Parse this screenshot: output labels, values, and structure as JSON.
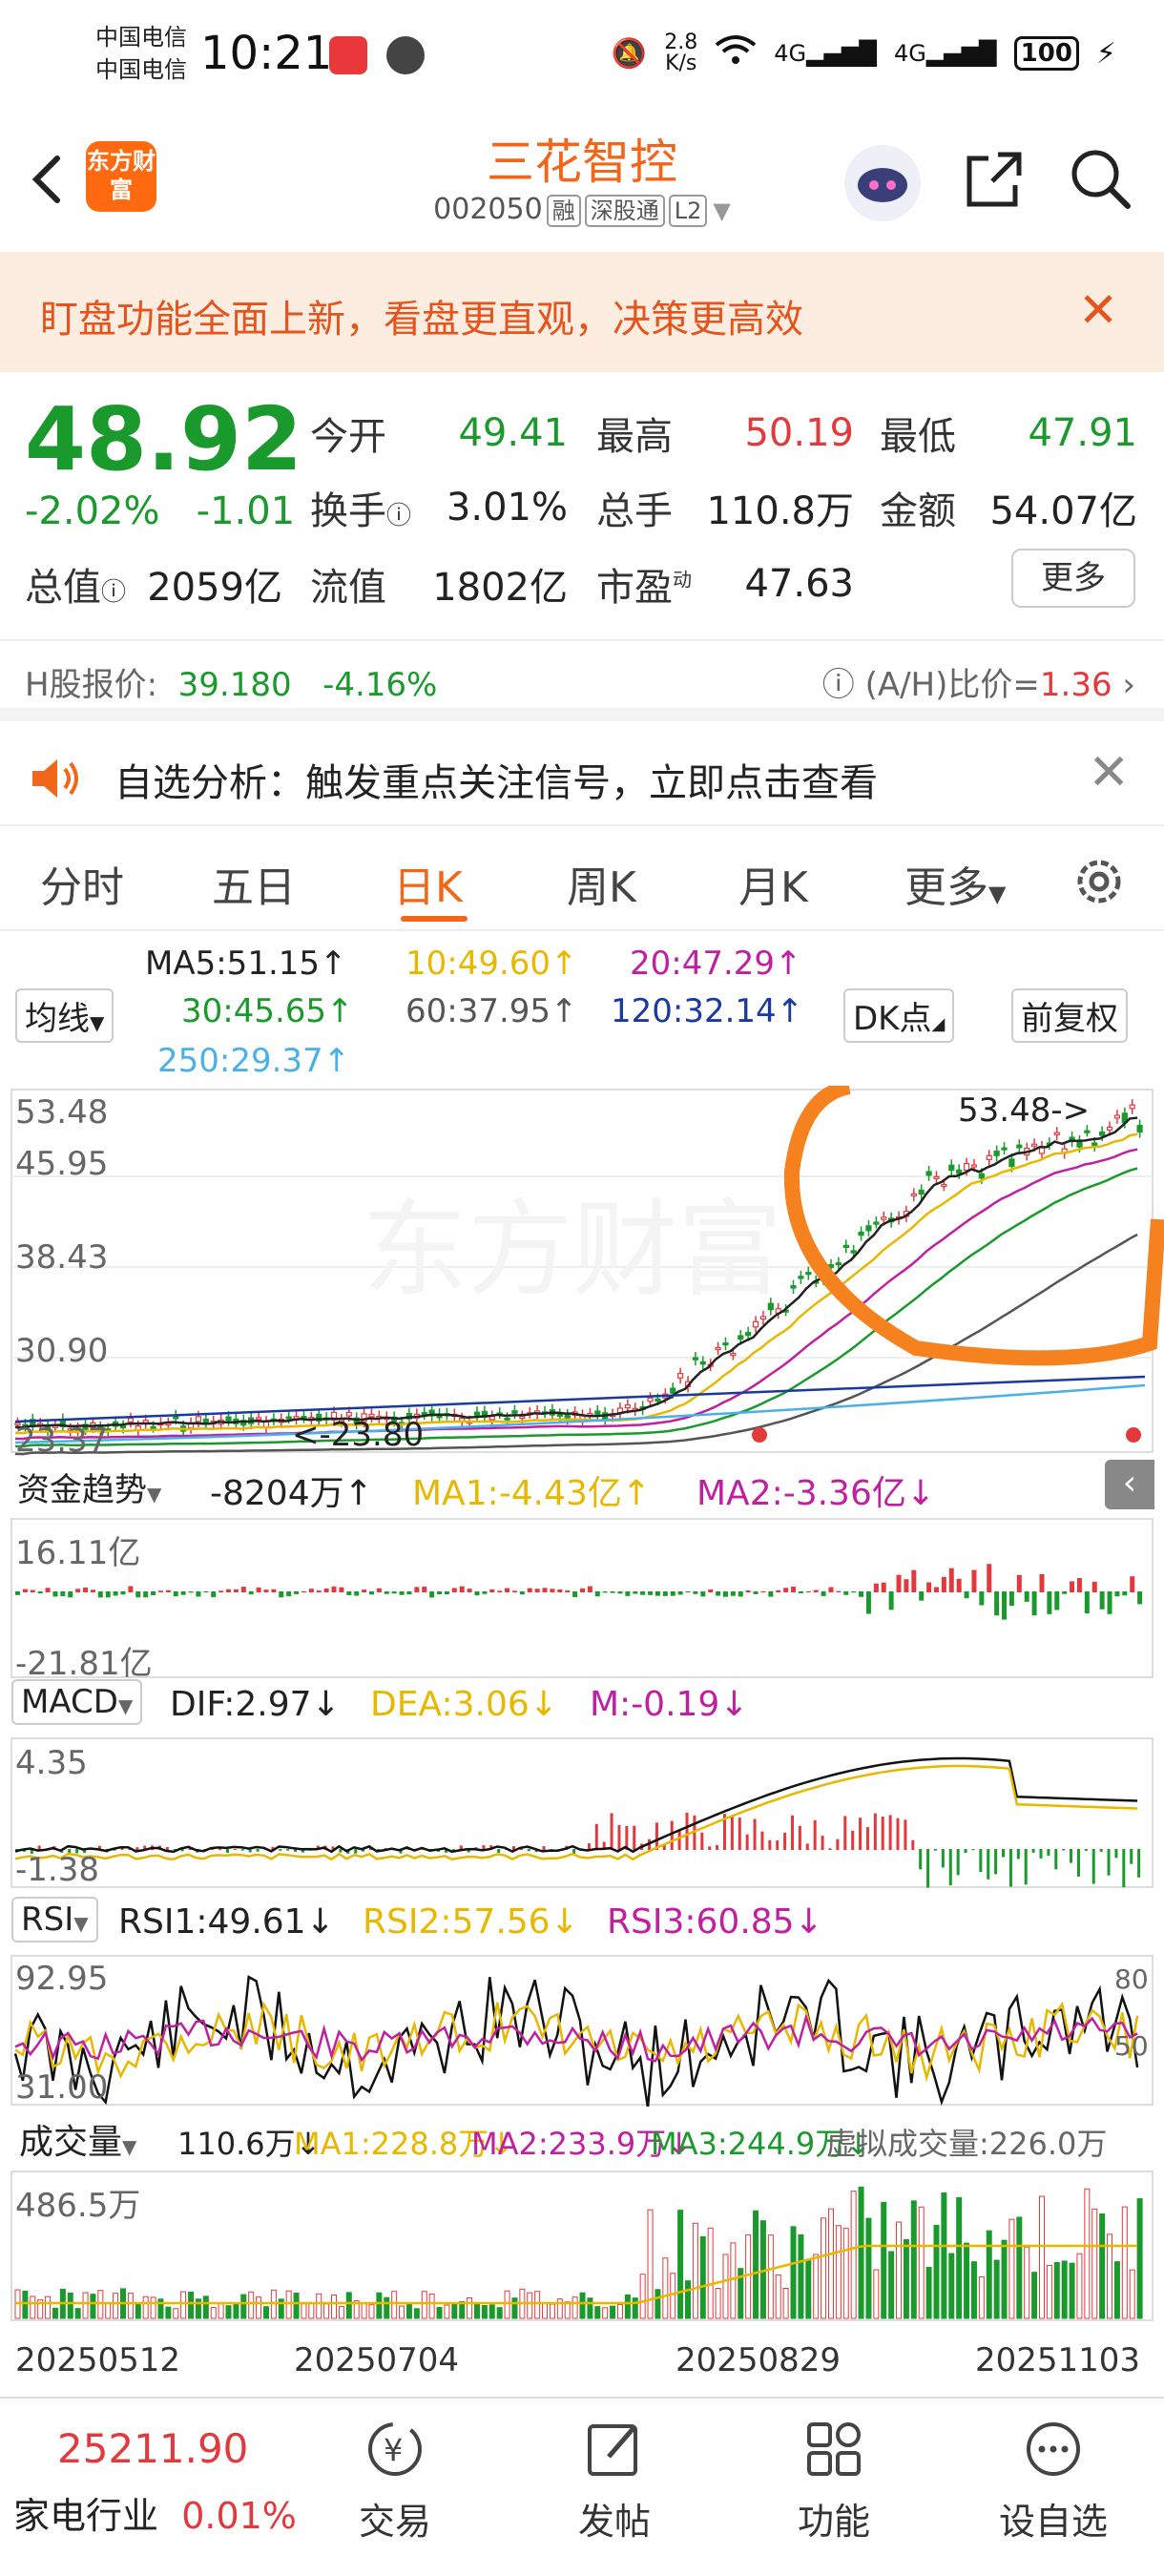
{
  "status_bar": {
    "carrier1": "中国电信",
    "carrier2": "中国电信",
    "time": "10:21",
    "net_speed_top": "2.8",
    "net_speed_bottom": "K/s",
    "signal1": "4G",
    "signal2": "4G",
    "battery": "100"
  },
  "header": {
    "logo_text": "东方财富",
    "stock_name": "三花智控",
    "stock_code": "002050",
    "tags": [
      "融",
      "深股通",
      "L2"
    ]
  },
  "banner": {
    "text": "盯盘功能全面上新，看盘更直观，决策更高效"
  },
  "quote": {
    "price": "48.92",
    "change_pct": "-2.02%",
    "change_abs": "-1.01",
    "open_label": "今开",
    "open": "49.41",
    "high_label": "最高",
    "high": "50.19",
    "low_label": "最低",
    "low": "47.91",
    "turnover_label": "换手",
    "turnover": "3.01%",
    "volume_label": "总手",
    "volume": "110.8万",
    "amount_label": "金额",
    "amount": "54.07亿",
    "mktcap_label": "总值",
    "mktcap": "2059亿",
    "float_label": "流值",
    "float_cap": "1802亿",
    "pe_label": "市盈",
    "pe_sup": "动",
    "pe": "47.63",
    "more_label": "更多"
  },
  "h_share": {
    "label": "H股报价:",
    "price": "39.180",
    "change": "-4.16%",
    "ratio_label": "(A/H)比价=",
    "ratio": "1.36"
  },
  "alert": {
    "text": "自选分析：触发重点关注信号，立即点击查看"
  },
  "tabs": [
    "分时",
    "五日",
    "日K",
    "周K",
    "月K",
    "更多"
  ],
  "active_tab": "日K",
  "ma_panel": {
    "ma5": "MA5:51.15↑",
    "ma10": "10:49.60↑",
    "ma20": "20:47.29↑",
    "ma30": "30:45.65↑",
    "ma60": "60:37.95↑",
    "ma120": "120:32.14↑",
    "ma250": "250:29.37↑",
    "junxian_btn": "均线",
    "dk_btn": "DK点",
    "fq_btn": "前复权",
    "colors": {
      "ma5": "#222222",
      "ma10": "#e8b800",
      "ma20": "#c020a0",
      "ma30": "#1a9a2c",
      "ma60": "#555555",
      "ma120": "#1a3aa0",
      "ma250": "#4ab0e8"
    }
  },
  "kline": {
    "y_labels": [
      "53.48",
      "45.95",
      "38.43",
      "30.90",
      "23.37"
    ],
    "high_marker": "53.48->",
    "low_marker": "<-23.80",
    "watermark": "东方财富"
  },
  "fund_flow": {
    "label": "资金趋势",
    "value": "-8204万↑",
    "ma1": "MA1:-4.43亿↑",
    "ma2": "MA2:-3.36亿↓",
    "y_top": "16.11亿",
    "y_bottom": "-21.81亿"
  },
  "macd": {
    "label": "MACD",
    "dif": "DIF:2.97↓",
    "dea": "DEA:3.06↓",
    "m": "M:-0.19↓",
    "y_top": "4.35",
    "y_bottom": "-1.38"
  },
  "rsi": {
    "label": "RSI",
    "rsi1": "RSI1:49.61↓",
    "rsi2": "RSI2:57.56↓",
    "rsi3": "RSI3:60.85↓",
    "y_top": "92.95",
    "y_bottom": "31.00",
    "r80": "80",
    "r50": "50"
  },
  "volume": {
    "label": "成交量",
    "value": "110.6万↓",
    "ma1": "MA1:228.8万↓",
    "ma2": "MA2:233.9万↓",
    "ma3": "MA3:244.9万↓",
    "virtual": "虚拟成交量:226.0万",
    "y_top": "486.5万"
  },
  "dates": [
    "20250512",
    "20250704",
    "20250829",
    "20251103"
  ],
  "bottom_nav": {
    "index_value": "25211.90",
    "index_name": "家电行业",
    "index_change": "0.01%",
    "items": [
      "交易",
      "发帖",
      "功能",
      "设自选"
    ]
  }
}
